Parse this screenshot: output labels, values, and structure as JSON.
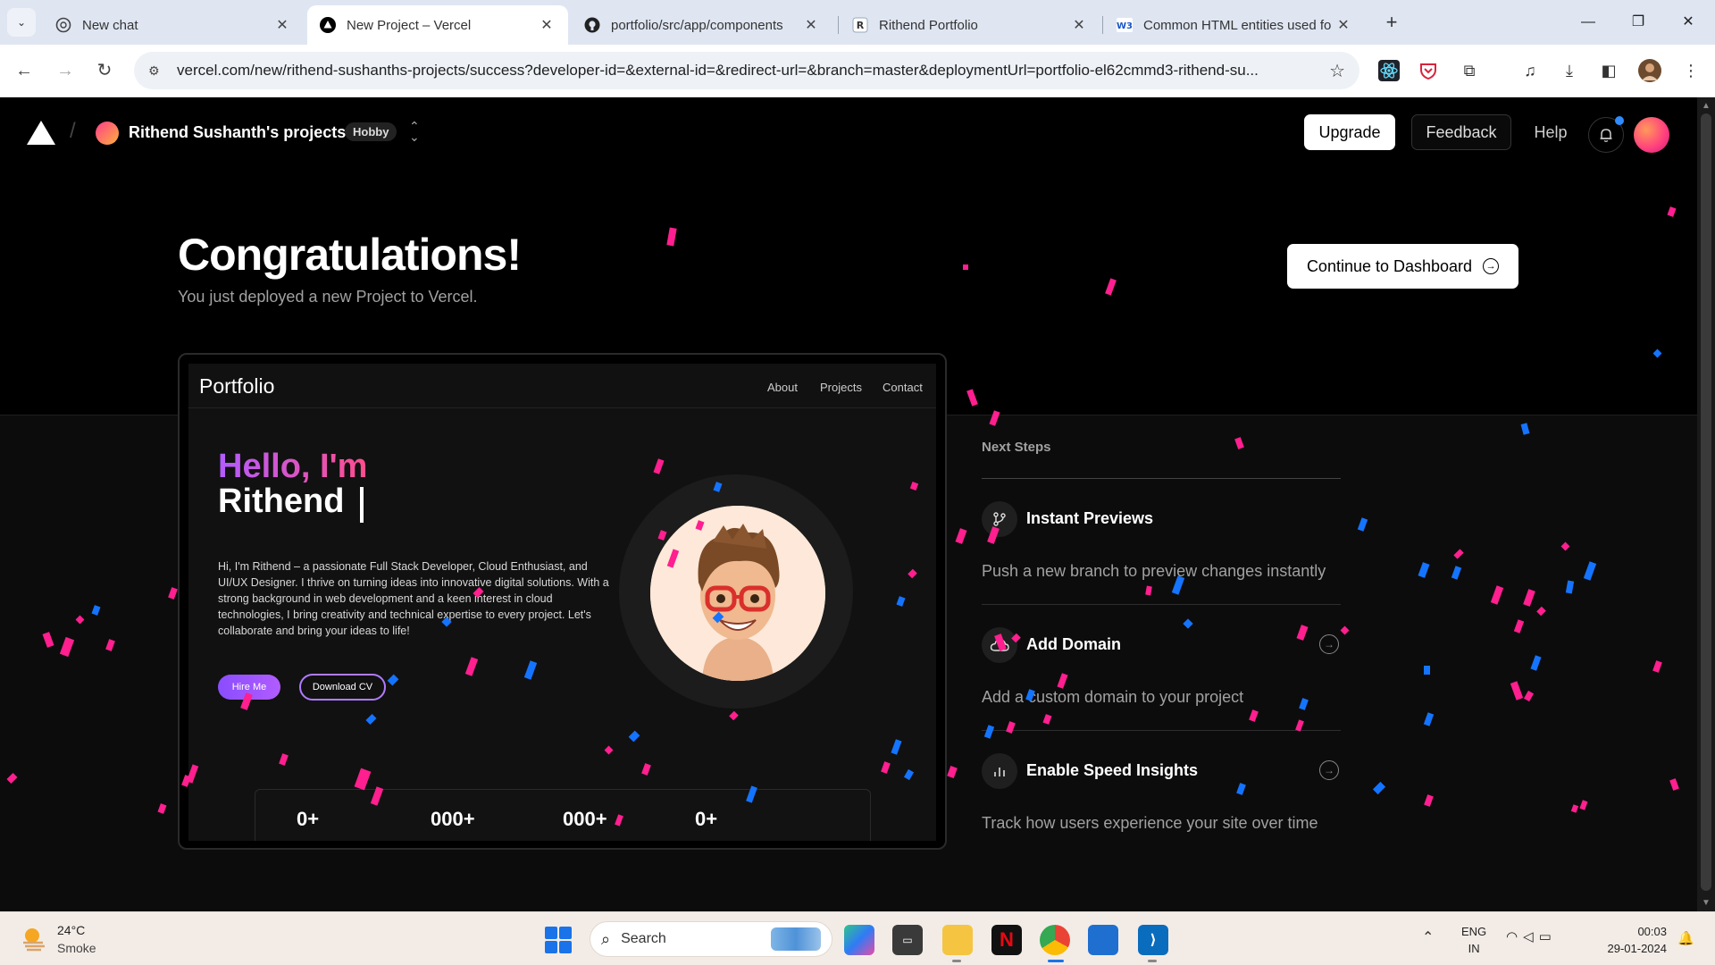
{
  "browser": {
    "tabs": [
      {
        "title": "New chat",
        "favicon": "chatgpt-icon"
      },
      {
        "title": "New Project – Vercel",
        "favicon": "vercel-icon",
        "active": true
      },
      {
        "title": "portfolio/src/app/components",
        "favicon": "github-icon"
      },
      {
        "title": "Rithend Portfolio",
        "favicon": "r-icon"
      },
      {
        "title": "Common HTML entities used fo",
        "favicon": "w3-icon"
      }
    ],
    "new_tab_label": "+",
    "url": "vercel.com/new/rithend-sushanths-projects/success?developer-id=&external-id=&redirect-url=&branch=master&deploymentUrl=portfolio-el62cmmd3-rithend-su..."
  },
  "header": {
    "team_name": "Rithend Sushanth's projects",
    "plan_badge": "Hobby",
    "upgrade_label": "Upgrade",
    "feedback_label": "Feedback",
    "help_label": "Help"
  },
  "hero": {
    "title": "Congratulations!",
    "subtitle": "You just deployed a new Project to Vercel.",
    "continue_label": "Continue to Dashboard"
  },
  "preview": {
    "brand": "Portfolio",
    "nav": [
      "About",
      "Projects",
      "Contact"
    ],
    "greeting": "Hello, I'm",
    "name": "Rithend",
    "bio": "Hi, I'm Rithend – a passionate Full Stack Developer, Cloud Enthusiast, and UI/UX Designer. I thrive on turning ideas into innovative digital solutions. With a strong background in web development and a keen interest in cloud technologies, I bring creativity and technical expertise to every project. Let's collaborate and bring your ideas to life!",
    "hire_label": "Hire Me",
    "cv_label": "Download CV",
    "stats": [
      "0+",
      "000+",
      "000+",
      "0+"
    ]
  },
  "next_steps": {
    "title": "Next Steps",
    "items": [
      {
        "title": "Instant Previews",
        "desc": "Push a new branch to preview changes instantly",
        "icon": "branch-icon"
      },
      {
        "title": "Add Domain",
        "desc": "Add a custom domain to your project",
        "icon": "cloud-icon"
      },
      {
        "title": "Enable Speed Insights",
        "desc": "Track how users experience your site over time",
        "icon": "bar-chart-icon"
      }
    ]
  },
  "taskbar": {
    "temperature": "24°C",
    "weather": "Smoke",
    "search_label": "Search",
    "lang_line1": "ENG",
    "lang_line2": "IN",
    "time": "00:03",
    "date": "29-01-2024"
  },
  "colors": {
    "accent_pink": "#ff1f8f",
    "accent_blue": "#1474ff",
    "page_bg": "#000000"
  }
}
